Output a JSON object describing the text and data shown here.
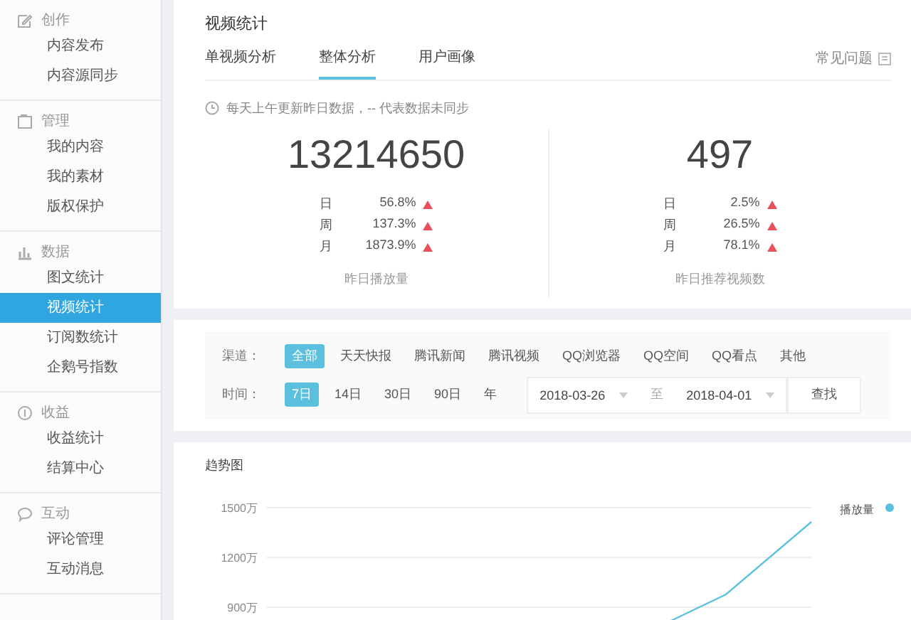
{
  "sidebar": {
    "sections": [
      {
        "label": "创作",
        "items": [
          {
            "label": "内容发布",
            "selected": false
          },
          {
            "label": "内容源同步",
            "selected": false
          }
        ]
      },
      {
        "label": "管理",
        "items": [
          {
            "label": "我的内容",
            "selected": false
          },
          {
            "label": "我的素材",
            "selected": false
          },
          {
            "label": "版权保护",
            "selected": false
          }
        ]
      },
      {
        "label": "数据",
        "items": [
          {
            "label": "图文统计",
            "selected": false
          },
          {
            "label": "视频统计",
            "selected": true
          },
          {
            "label": "订阅数统计",
            "selected": false
          },
          {
            "label": "企鹅号指数",
            "selected": false
          }
        ]
      },
      {
        "label": "收益",
        "items": [
          {
            "label": "收益统计",
            "selected": false
          },
          {
            "label": "结算中心",
            "selected": false
          }
        ]
      },
      {
        "label": "互动",
        "items": [
          {
            "label": "评论管理",
            "selected": false
          },
          {
            "label": "互动消息",
            "selected": false
          }
        ]
      }
    ]
  },
  "page": {
    "title": "视频统计",
    "tabs": [
      {
        "label": "单视频分析",
        "selected": false
      },
      {
        "label": "整体分析",
        "selected": true
      },
      {
        "label": "用户画像",
        "selected": false
      }
    ],
    "help_link": "常见问题",
    "notice": "每天上午更新昨日数据，-- 代表数据未同步",
    "stats": [
      {
        "value": "13214650",
        "caption": "昨日播放量",
        "changes": [
          {
            "period": "日",
            "percent": "56.8%"
          },
          {
            "period": "周",
            "percent": "137.3%"
          },
          {
            "period": "月",
            "percent": "1873.9%"
          }
        ]
      },
      {
        "value": "497",
        "caption": "昨日推荐视频数",
        "changes": [
          {
            "period": "日",
            "percent": "2.5%"
          },
          {
            "period": "周",
            "percent": "26.5%"
          },
          {
            "period": "月",
            "percent": "78.1%"
          }
        ]
      }
    ],
    "filters": {
      "channel_label": "渠道：",
      "channels": [
        {
          "label": "全部",
          "selected": true
        },
        {
          "label": "天天快报",
          "selected": false
        },
        {
          "label": "腾讯新闻",
          "selected": false
        },
        {
          "label": "腾讯视频",
          "selected": false
        },
        {
          "label": "QQ浏览器",
          "selected": false
        },
        {
          "label": "QQ空间",
          "selected": false
        },
        {
          "label": "QQ看点",
          "selected": false
        },
        {
          "label": "其他",
          "selected": false
        }
      ],
      "time_label": "时间：",
      "periods": [
        {
          "label": "7日",
          "selected": true
        },
        {
          "label": "14日",
          "selected": false
        },
        {
          "label": "30日",
          "selected": false
        },
        {
          "label": "90日",
          "selected": false
        },
        {
          "label": "年",
          "selected": false
        }
      ],
      "start_date": "2018-03-26",
      "separator": "至",
      "end_date": "2018-04-01",
      "search_button": "查找"
    },
    "trend": {
      "title": "趋势图",
      "y_axis_labels": [
        "1500万",
        "1200万",
        "900万"
      ],
      "legend_label": "播放量"
    }
  }
}
